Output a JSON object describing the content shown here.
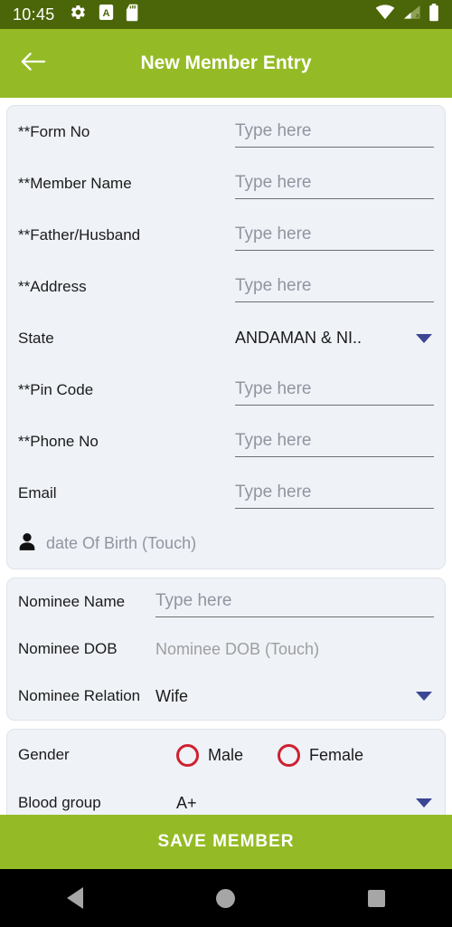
{
  "status_bar": {
    "time": "10:45",
    "left_icons": [
      "gear-icon",
      "letter-a-badge-icon",
      "sd-card-icon"
    ],
    "right_icons": [
      "wifi-icon",
      "cellular-no-sim-icon",
      "battery-full-icon"
    ],
    "background_color": "#4b6608"
  },
  "app_bar": {
    "title": "New Member Entry",
    "back_icon": "arrow-left-icon",
    "background_color": "#94bb25",
    "text_color": "#ffffff"
  },
  "member_card": {
    "placeholder": "Type here",
    "fields": [
      {
        "label": "**Form No",
        "type": "text"
      },
      {
        "label": "**Member Name",
        "type": "text"
      },
      {
        "label": "**Father/Husband",
        "type": "text"
      },
      {
        "label": "**Address",
        "type": "text"
      }
    ],
    "state": {
      "label": "State",
      "value": "ANDAMAN & NI..",
      "caret_icon": "chevron-down-icon"
    },
    "fields2": [
      {
        "label": "**Pin Code",
        "type": "text"
      },
      {
        "label": "**Phone No",
        "type": "text"
      },
      {
        "label": "Email",
        "type": "text"
      }
    ],
    "dob": {
      "icon": "person-icon",
      "text": "date Of Birth (Touch)"
    }
  },
  "nominee_card": {
    "name": {
      "label": "Nominee Name",
      "placeholder": "Type here"
    },
    "dob": {
      "label": "Nominee DOB",
      "value": "Nominee DOB (Touch)"
    },
    "relation": {
      "label": "Nominee Relation",
      "value": "Wife",
      "caret_icon": "chevron-down-icon"
    }
  },
  "gender_card": {
    "gender": {
      "label": "Gender",
      "options": [
        {
          "label": "Male",
          "selected": false
        },
        {
          "label": "Female",
          "selected": false
        }
      ],
      "radio_color": "#cf2030"
    },
    "blood_group": {
      "label": "Blood group",
      "value": "A+",
      "caret_icon": "chevron-down-icon"
    }
  },
  "save_button": {
    "label": "SAVE MEMBER",
    "background_color": "#94bb25"
  },
  "nav_bar": {
    "back": "triangle-back-icon",
    "home": "circle-home-icon",
    "recents": "square-recents-icon"
  }
}
